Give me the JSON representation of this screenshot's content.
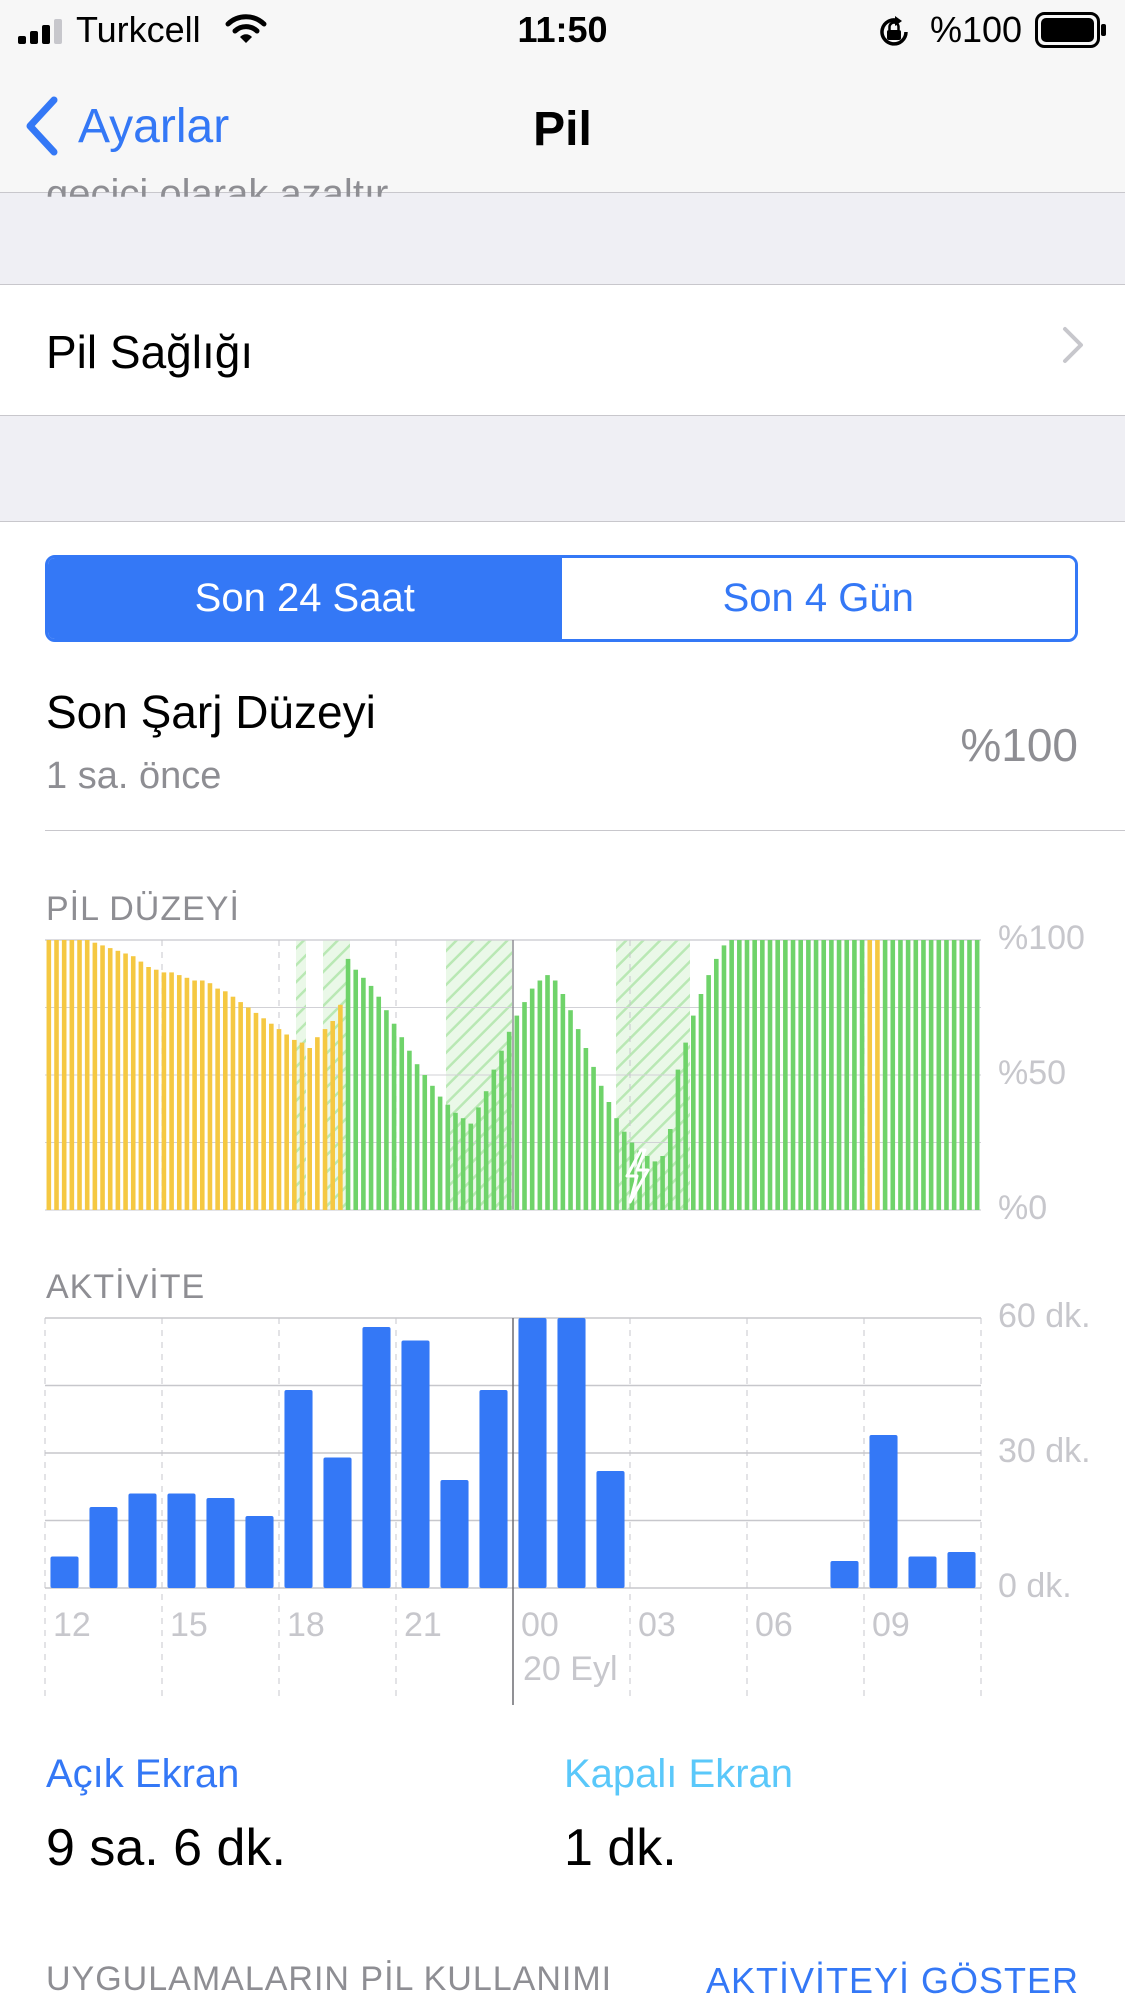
{
  "status_bar": {
    "carrier": "Turkcell",
    "time": "11:50",
    "battery_percent": "%100"
  },
  "nav": {
    "back_label": "Ayarlar",
    "title": "Pil"
  },
  "partial_text": "geçici olarak azaltır.",
  "battery_health": {
    "label": "Pil Sağlığı"
  },
  "segments": {
    "left": "Son 24 Saat",
    "right": "Son 4 Gün",
    "selected": "left"
  },
  "last_charge": {
    "title": "Son Şarj Düzeyi",
    "subtitle": "1 sa. önce",
    "value": "%100"
  },
  "battery_chart": {
    "section_title": "PİL DÜZEYİ",
    "y_labels": [
      "%100",
      "%50",
      "%0"
    ]
  },
  "activity_chart": {
    "section_title": "AKTİVİTE",
    "y_labels": [
      "60 dk.",
      "30 dk.",
      "0 dk."
    ],
    "x_labels": [
      "12",
      "15",
      "18",
      "21",
      "00",
      "03",
      "06",
      "09"
    ],
    "date_label": "20 Eyl"
  },
  "screen_on": {
    "label": "Açık Ekran",
    "value": "9 sa. 6 dk."
  },
  "screen_off": {
    "label": "Kapalı Ekran",
    "value": "1 dk."
  },
  "footer": {
    "left": "UYGULAMALARIN PİL KULLANIMI",
    "right": "AKTİVİTEYİ GÖSTER"
  },
  "colors": {
    "accent": "#3478f6",
    "battery_green": "#6fd36a",
    "battery_yellow": "#f5c842",
    "gray": "#8e8e93",
    "light_blue": "#5ac8fa"
  },
  "chart_data": [
    {
      "type": "bar",
      "title": "PİL DÜZEYİ",
      "ylabel": "",
      "ylim": [
        0,
        100
      ],
      "unit": "%",
      "series": [
        {
          "values": [
            100,
            100,
            100,
            100,
            100,
            100,
            99,
            98,
            97,
            96,
            95,
            94,
            92,
            90,
            89,
            88,
            88,
            87,
            86,
            85,
            85,
            84,
            82,
            81,
            79,
            77,
            75,
            73,
            71,
            69,
            67,
            65,
            63,
            62,
            60,
            64,
            67,
            70,
            76,
            93,
            89,
            86,
            83,
            79,
            74,
            69,
            64,
            59,
            54,
            50,
            46,
            42,
            39,
            36,
            34,
            32,
            38,
            44,
            52,
            59,
            66,
            72,
            77,
            82,
            85,
            87,
            85,
            80,
            74,
            67,
            60,
            53,
            46,
            40,
            34,
            29,
            25,
            22,
            20,
            18,
            20,
            30,
            52,
            62,
            72,
            80,
            87,
            93,
            98,
            100,
            100,
            100,
            100,
            100,
            100,
            100,
            100,
            100,
            100,
            100,
            100,
            100,
            100,
            100,
            100,
            100,
            100,
            100,
            100,
            100,
            100,
            100,
            100,
            100,
            100,
            100,
            100,
            100,
            100,
            100,
            100,
            100
          ]
        }
      ],
      "colors": [
        "#f5c842",
        "#f5c842",
        "#f5c842",
        "#f5c842",
        "#f5c842",
        "#f5c842",
        "#f5c842",
        "#f5c842",
        "#f5c842",
        "#f5c842",
        "#f5c842",
        "#f5c842",
        "#f5c842",
        "#f5c842",
        "#f5c842",
        "#f5c842",
        "#f5c842",
        "#f5c842",
        "#f5c842",
        "#f5c842",
        "#f5c842",
        "#f5c842",
        "#f5c842",
        "#f5c842",
        "#f5c842",
        "#f5c842",
        "#f5c842",
        "#f5c842",
        "#f5c842",
        "#f5c842",
        "#f5c842",
        "#f5c842",
        "#f5c842",
        "#f5c842",
        "#f5c842",
        "#f5c842",
        "#f5c842",
        "#f5c842",
        "#f5c842",
        "#6fd36a",
        "#6fd36a",
        "#6fd36a",
        "#6fd36a",
        "#6fd36a",
        "#6fd36a",
        "#6fd36a",
        "#6fd36a",
        "#6fd36a",
        "#6fd36a",
        "#6fd36a",
        "#6fd36a",
        "#6fd36a",
        "#6fd36a",
        "#6fd36a",
        "#6fd36a",
        "#6fd36a",
        "#6fd36a",
        "#6fd36a",
        "#6fd36a",
        "#6fd36a",
        "#6fd36a",
        "#6fd36a",
        "#6fd36a",
        "#6fd36a",
        "#6fd36a",
        "#6fd36a",
        "#6fd36a",
        "#6fd36a",
        "#6fd36a",
        "#6fd36a",
        "#6fd36a",
        "#6fd36a",
        "#6fd36a",
        "#6fd36a",
        "#6fd36a",
        "#6fd36a",
        "#6fd36a",
        "#6fd36a",
        "#6fd36a",
        "#6fd36a",
        "#6fd36a",
        "#6fd36a",
        "#6fd36a",
        "#6fd36a",
        "#6fd36a",
        "#6fd36a",
        "#6fd36a",
        "#6fd36a",
        "#6fd36a",
        "#6fd36a",
        "#6fd36a",
        "#6fd36a",
        "#6fd36a",
        "#6fd36a",
        "#6fd36a",
        "#6fd36a",
        "#6fd36a",
        "#6fd36a",
        "#6fd36a",
        "#6fd36a",
        "#6fd36a",
        "#6fd36a",
        "#6fd36a",
        "#6fd36a",
        "#6fd36a",
        "#6fd36a",
        "#6fd36a",
        "#f5c842",
        "#f5c842",
        "#6fd36a",
        "#6fd36a",
        "#6fd36a",
        "#6fd36a",
        "#6fd36a",
        "#6fd36a",
        "#6fd36a",
        "#6fd36a",
        "#6fd36a",
        "#6fd36a",
        "#6fd36a",
        "#6fd36a",
        "#6fd36a"
      ]
    },
    {
      "type": "bar",
      "title": "AKTİVİTE",
      "ylabel": "",
      "ylim": [
        0,
        60
      ],
      "unit": "dk.",
      "categories": [
        "12",
        "13",
        "14",
        "15",
        "16",
        "17",
        "18",
        "19",
        "20",
        "21",
        "22",
        "23",
        "00",
        "01",
        "02",
        "03",
        "04",
        "05",
        "06",
        "07",
        "08",
        "09",
        "10",
        "11"
      ],
      "series": [
        {
          "values": [
            7,
            18,
            21,
            21,
            20,
            16,
            44,
            29,
            58,
            55,
            24,
            44,
            60,
            60,
            26,
            0,
            0,
            0,
            0,
            0,
            6,
            34,
            7,
            8
          ]
        }
      ]
    }
  ]
}
